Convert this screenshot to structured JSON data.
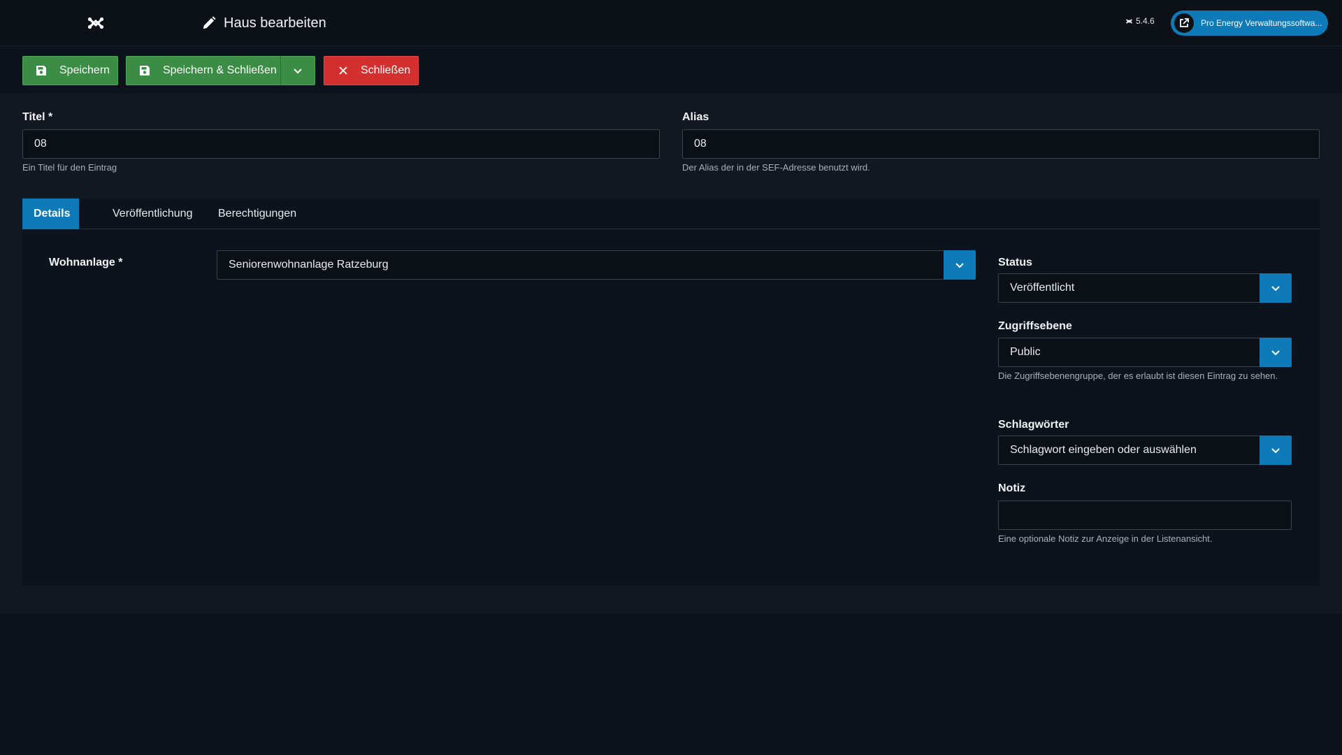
{
  "header": {
    "title": "Haus bearbeiten",
    "version": "5.4.6",
    "site_button_label": "Pro Energy Verwaltungssoftwa..."
  },
  "toolbar": {
    "save_label": "Speichern",
    "save_close_label": "Speichern & Schließen",
    "close_label": "Schließen"
  },
  "form": {
    "title_label": "Titel *",
    "title_value": "08",
    "title_hint": "Ein Titel für den Eintrag",
    "alias_label": "Alias",
    "alias_value": "08",
    "alias_hint": "Der Alias der in der SEF-Adresse benutzt wird."
  },
  "tabs": [
    {
      "label": "Details",
      "active": true
    },
    {
      "label": "Veröffentlichung",
      "active": false
    },
    {
      "label": "Berechtigungen",
      "active": false
    }
  ],
  "details": {
    "wohnanlage_label": "Wohnanlage *",
    "wohnanlage_value": "Seniorenwohnanlage Ratzeburg",
    "status_label": "Status",
    "status_value": "Veröffentlicht",
    "access_label": "Zugriffsebene",
    "access_value": "Public",
    "access_hint": "Die Zugriffsebenengruppe, der es erlaubt ist diesen Eintrag zu sehen.",
    "tags_label": "Schlagwörter",
    "tags_placeholder": "Schlagwort eingeben oder auswählen",
    "note_label": "Notiz",
    "note_value": "",
    "note_hint": "Eine optionale Notiz zur Anzeige in der Listenansicht."
  },
  "icons": {
    "logo": "joomla-logo-icon",
    "edit": "pencil-icon",
    "external": "external-link-icon",
    "save": "floppy-disk-icon",
    "close": "x-icon",
    "dropdown": "chevron-down-icon"
  },
  "colors": {
    "primary": "#0f7ab8",
    "success": "#3b8d45",
    "danger": "#d32f2f",
    "background": "#121821"
  }
}
